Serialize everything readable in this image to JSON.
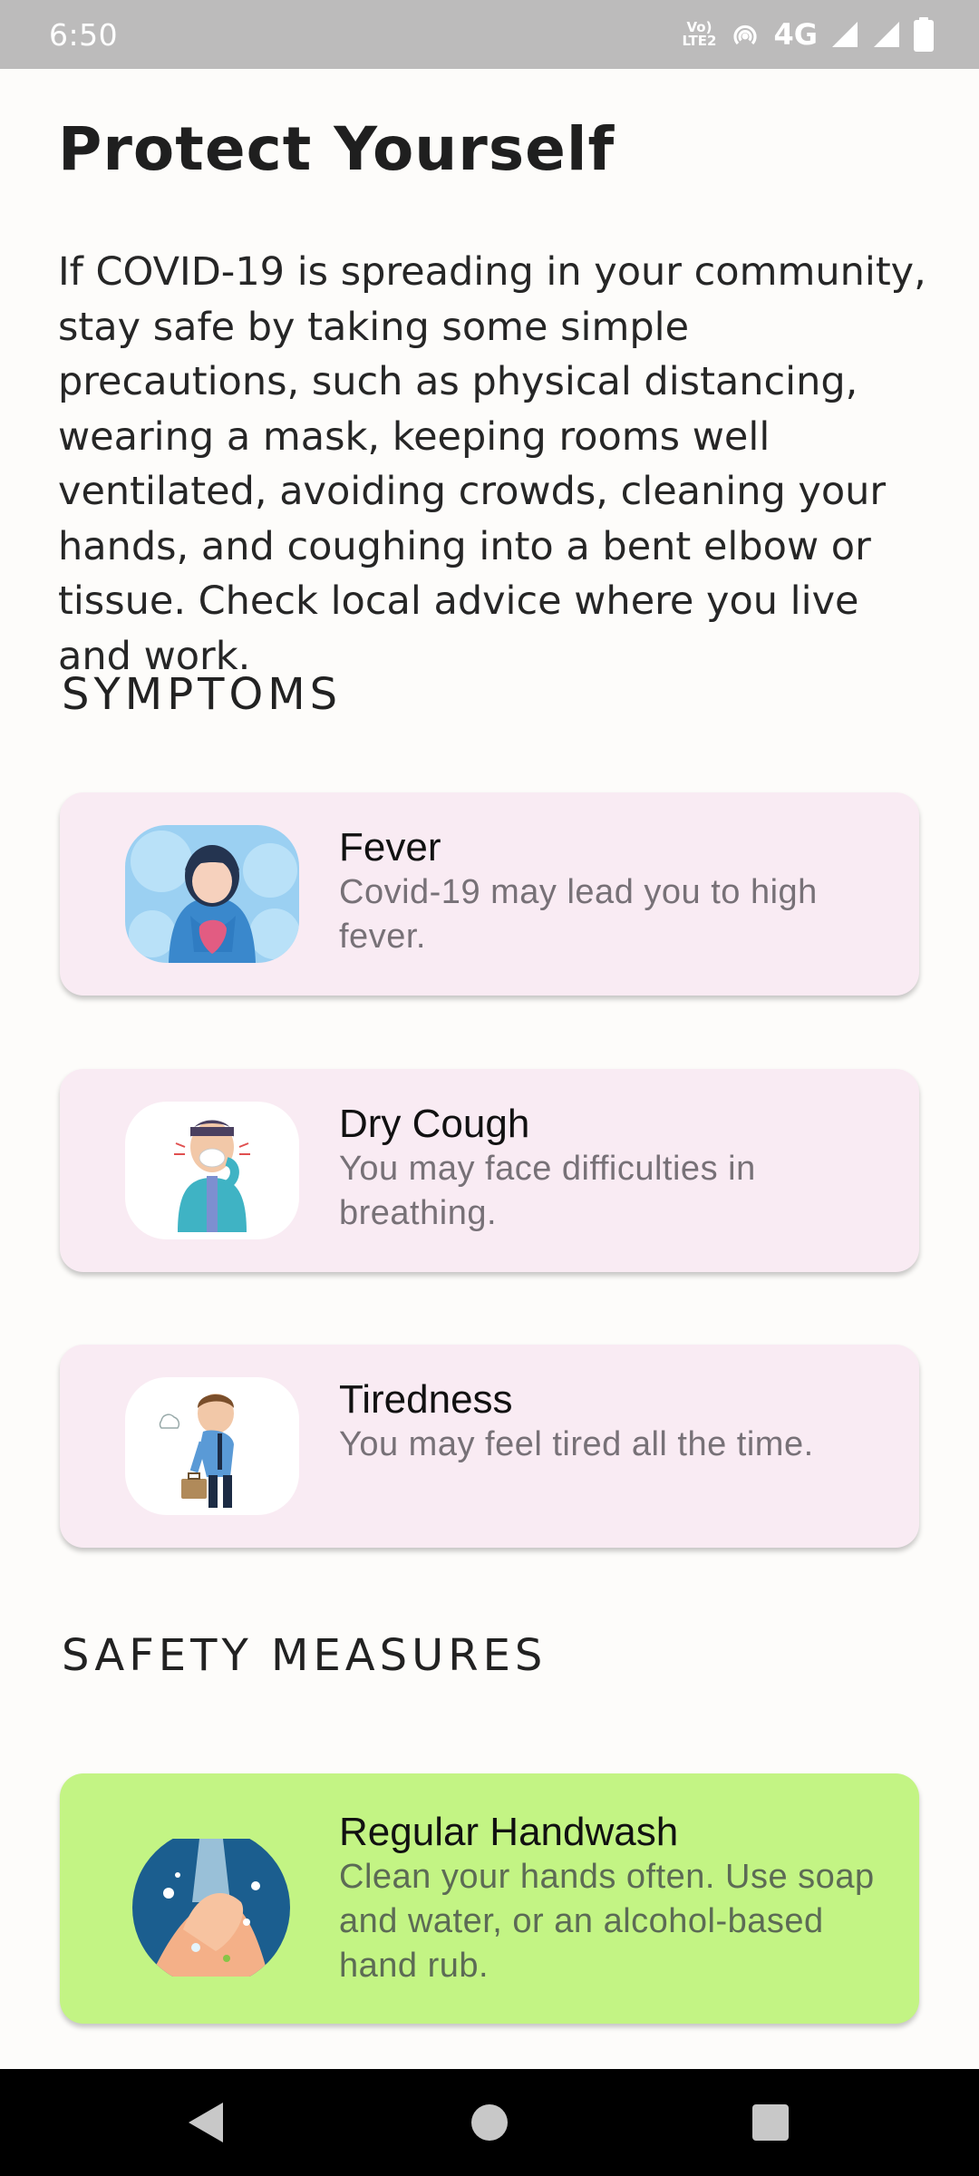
{
  "status_bar": {
    "time": "6:50",
    "lte_label": "Vo) LTE2",
    "network": "4G",
    "icons": [
      "volte-icon",
      "hotspot-icon",
      "signal-icon",
      "signal-icon",
      "battery-icon"
    ]
  },
  "page": {
    "title": "Protect Yourself",
    "intro": "If COVID-19 is spreading in your community, stay safe by taking some simple precautions, such as physical distancing, wearing a mask, keeping rooms well ventilated, avoiding crowds, cleaning your hands, and coughing into a bent elbow or tissue. Check local advice where you live and work."
  },
  "symptoms": {
    "header": "SYMPTOMS",
    "items": [
      {
        "title": "Fever",
        "description": "Covid-19 may lead you to high fever.",
        "icon": "fever-illustration"
      },
      {
        "title": "Dry Cough",
        "description": "You may face difficulties in breathing.",
        "icon": "cough-illustration"
      },
      {
        "title": "Tiredness",
        "description": "You may feel tired all the time.",
        "icon": "tiredness-illustration"
      }
    ]
  },
  "safety": {
    "header": "SAFETY MEASURES",
    "items": [
      {
        "title": "Regular Handwash",
        "description": "Clean your hands often. Use soap and water, or an alcohol-based hand rub.",
        "icon": "handwash-illustration"
      }
    ]
  },
  "colors": {
    "symptom_card": "#f9ebf3",
    "safety_card": "#c3f484",
    "status_bar": "#bcbbbb",
    "nav_bar": "#000000"
  },
  "nav_bar": {
    "buttons": [
      "back-icon",
      "home-icon",
      "recents-icon"
    ]
  }
}
